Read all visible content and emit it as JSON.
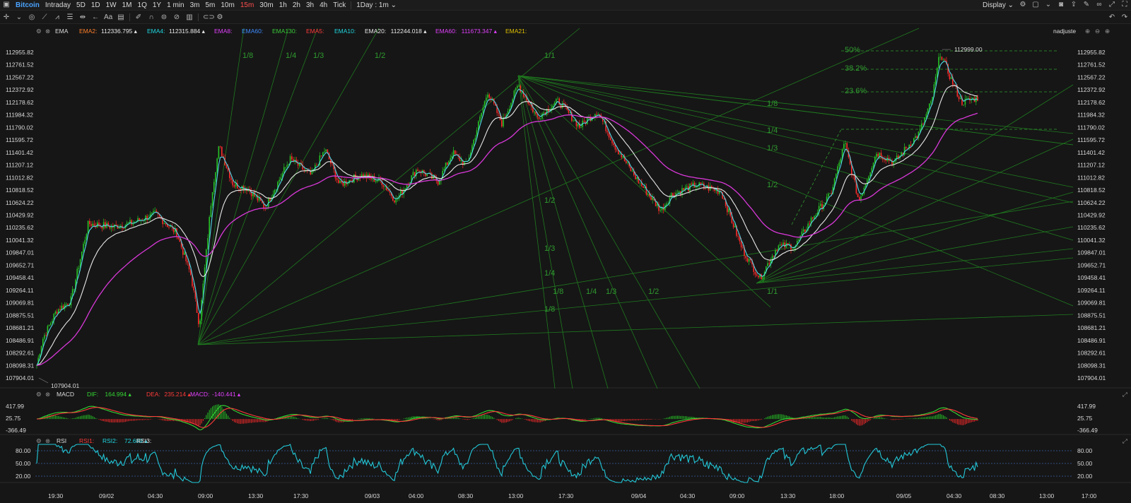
{
  "topbar": {
    "symbol": "Bitcoin",
    "timeframes": [
      "Intraday",
      "5D",
      "1D",
      "1W",
      "1M",
      "1Q",
      "1Y",
      "1 min",
      "3m",
      "5m",
      "10m",
      "15m",
      "30m",
      "1h",
      "2h",
      "3h",
      "4h",
      "Tick"
    ],
    "active_timeframe": "15m",
    "range_select": "1Day : 1m",
    "display_label": "Display"
  },
  "main_legend": {
    "indicator": "EMA",
    "items": [
      {
        "label": "EMA2:",
        "value": "112336.795",
        "color": "#ff7f2a"
      },
      {
        "label": "EMA4:",
        "value": "112315.884",
        "color": "#1fd6e0"
      },
      {
        "label": "EMA8:",
        "value": "",
        "color": "#e040fb"
      },
      {
        "label": "EMA60:",
        "value": "",
        "color": "#3d8bff"
      },
      {
        "label": "EMA130:",
        "value": "",
        "color": "#39c939"
      },
      {
        "label": "EMA5:",
        "value": "",
        "color": "#ff3a3a"
      },
      {
        "label": "EMA10:",
        "value": "",
        "color": "#1fd6e0"
      },
      {
        "label": "EMA20:",
        "value": "112244.018",
        "color": "#e8e8e8"
      },
      {
        "label": "EMA60:",
        "value": "111673.347",
        "color": "#e040fb"
      },
      {
        "label": "EMA21:",
        "value": "",
        "color": "#e0c000"
      }
    ],
    "right_label": "nadjuste"
  },
  "price_axis": [
    "112955.82",
    "112761.52",
    "112567.22",
    "112372.92",
    "112178.62",
    "111984.32",
    "111790.02",
    "111595.72",
    "111401.42",
    "111207.12",
    "111012.82",
    "110818.52",
    "110624.22",
    "110429.92",
    "110235.62",
    "110041.32",
    "109847.01",
    "109652.71",
    "109458.41",
    "109264.11",
    "109069.81",
    "108875.51",
    "108681.21",
    "108486.91",
    "108292.61",
    "108098.31",
    "107904.01"
  ],
  "high_label": "112999.00",
  "low_label": "107904.01",
  "fib_labels": [
    "50%",
    "38.2%",
    "23.6%"
  ],
  "gann_labels": {
    "fan1": [
      "1/8",
      "1/4",
      "1/3",
      "1/2",
      "1/1"
    ],
    "fan2": [
      "1/2",
      "1/3",
      "1/4",
      "1/8",
      "1/4",
      "1/3",
      "1/2",
      "1/8"
    ],
    "fan3": [
      "1/8",
      "1/4",
      "1/3",
      "1/2",
      "1/1"
    ]
  },
  "macd_legend": {
    "indicator": "MACD",
    "items": [
      {
        "label": "DIF:",
        "value": "164.994",
        "color": "#33d633"
      },
      {
        "label": "DEA:",
        "value": "235.214",
        "color": "#ff3a3a"
      },
      {
        "label": "MACD:",
        "value": "-140.441",
        "color": "#e040fb"
      }
    ]
  },
  "macd_axis": [
    "417.99",
    "25.75",
    "-366.49"
  ],
  "rsi_legend": {
    "indicator": "RSI",
    "items": [
      {
        "label": "RSI1:",
        "value": "",
        "color": "#ff3a3a"
      },
      {
        "label": "RSI2:",
        "value": "72.689",
        "color": "#1fd6e0"
      },
      {
        "label": "RSI3:",
        "value": "",
        "color": "#e8e8e8"
      }
    ]
  },
  "rsi_axis": [
    "80.00",
    "50.00",
    "20.00"
  ],
  "time_axis": [
    "19:30",
    "09/02",
    "04:30",
    "09:00",
    "13:30",
    "17:30",
    "09/03",
    "04:00",
    "08:30",
    "13:00",
    "17:30",
    "09/04",
    "04:30",
    "09:00",
    "13:30",
    "18:00",
    "09/05",
    "04:30",
    "08:30",
    "13:00",
    "17:00"
  ]
}
